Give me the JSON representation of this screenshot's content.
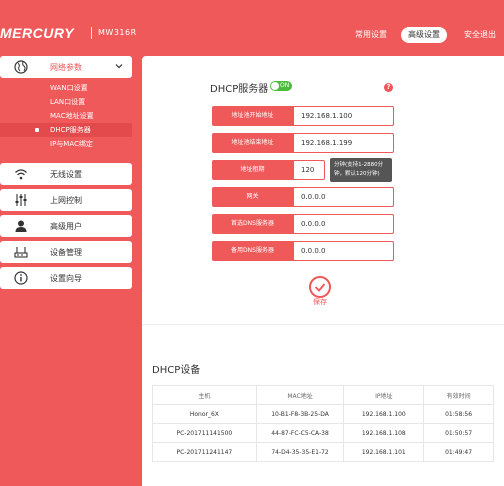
{
  "header": {
    "logo": "MERCURY",
    "model": "MW316R",
    "nav": [
      {
        "label": "常用设置",
        "active": false
      },
      {
        "label": "高级设置",
        "active": true
      },
      {
        "label": "安全退出",
        "active": false
      }
    ]
  },
  "sidebar": {
    "network": {
      "label": "网络参数"
    },
    "sub_items": [
      {
        "label": "WAN口设置"
      },
      {
        "label": "LAN口设置"
      },
      {
        "label": "MAC地址设置"
      },
      {
        "label": "DHCP服务器"
      },
      {
        "label": "IP与MAC绑定"
      }
    ],
    "items": [
      {
        "label": "无线设置",
        "icon": "wifi-icon"
      },
      {
        "label": "上网控制",
        "icon": "sliders-icon"
      },
      {
        "label": "高级用户",
        "icon": "user-icon"
      },
      {
        "label": "设备管理",
        "icon": "router-icon"
      },
      {
        "label": "设置向导",
        "icon": "info-icon"
      }
    ]
  },
  "dhcp": {
    "title": "DHCP服务器",
    "toggle_label": "ON",
    "help": "?",
    "fields": [
      {
        "label": "地址池开始地址",
        "value": "192.168.1.100"
      },
      {
        "label": "地址池结束地址",
        "value": "192.168.1.199"
      },
      {
        "label": "地址租期",
        "value": "120"
      },
      {
        "label": "网关",
        "value": "0.0.0.0"
      },
      {
        "label": "首选DNS服务器",
        "value": "0.0.0.0"
      },
      {
        "label": "备用DNS服务器",
        "value": "0.0.0.0"
      }
    ],
    "lease_tip_1": "分钟(支持1-2880分",
    "lease_tip_2": "钟，默认120分钟)",
    "save_label": "保存"
  },
  "devices": {
    "title": "DHCP设备",
    "columns": [
      "主机",
      "MAC地址",
      "IP地址",
      "有效时间"
    ],
    "rows": [
      [
        "Honor_6X",
        "10-B1-F8-3B-25-DA",
        "192.168.1.100",
        "01:58:56"
      ],
      [
        "PC-201711141500",
        "44-87-FC-C5-CA-38",
        "192.168.1.108",
        "01:50:57"
      ],
      [
        "PC-201711241147",
        "74-D4-35-35-E1-72",
        "192.168.1.101",
        "01:49:47"
      ]
    ]
  },
  "colors": {
    "accent": "#f0595a",
    "toggle_on": "#4cbb3b"
  }
}
